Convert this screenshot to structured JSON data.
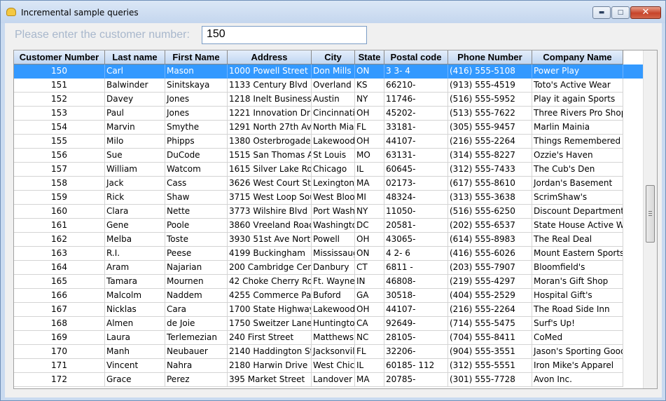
{
  "window": {
    "title": "Incremental sample queries"
  },
  "prompt": {
    "label": "Please enter the customer number:",
    "value": "150"
  },
  "grid": {
    "columns": [
      "Customer Number",
      "Last name",
      "First Name",
      "Address",
      "City",
      "State",
      "Postal code",
      "Phone Number",
      "Company Name"
    ],
    "selected_row": 0,
    "rows": [
      [
        "150",
        "Carl",
        "Mason",
        "1000 Powell Street",
        "Don Mills",
        "ON",
        "3  3- 4",
        "(416) 555-5108",
        "Power Play"
      ],
      [
        "151",
        "Balwinder",
        "Sinitskaya",
        "1133 Century Blvd",
        "Overland P",
        "KS",
        "66210-",
        "(913) 555-4519",
        "Toto's Active Wear"
      ],
      [
        "152",
        "Davey",
        "Jones",
        "1218 Inelt Business C",
        "Austin",
        "NY",
        "11746-",
        "(516) 555-5952",
        "Play it again Sports"
      ],
      [
        "153",
        "Paul",
        "Jones",
        "1221 Innovation Drive",
        "Cincinnati",
        "OH",
        "45202-",
        "(513) 555-7622",
        "Three Rivers Pro Shop"
      ],
      [
        "154",
        "Marvin",
        "Smythe",
        "1291 North 27th Ave",
        "North Miam",
        "FL",
        "33181-",
        "(305) 555-9457",
        "Marlin Mainia"
      ],
      [
        "155",
        "Milo",
        "Phipps",
        "1380 Osterbrogade",
        "Lakewood",
        "OH",
        "44107-",
        "(216) 555-2264",
        "Things Remembered"
      ],
      [
        "156",
        "Sue",
        "DuCode",
        "1515 San Thomas Av",
        "St Louis",
        "MO",
        "63131-",
        "(314) 555-8227",
        "Ozzie's Haven"
      ],
      [
        "157",
        "William",
        "Watcom",
        "1615 Silver Lake Road",
        "Chicago",
        "IL",
        "60645-",
        "(312) 555-7433",
        "The Cub's Den"
      ],
      [
        "158",
        "Jack",
        "Cass",
        "3626 West Court Stre",
        "Lexington",
        "MA",
        "02173-",
        "(617) 555-8610",
        "Jordan's Basement"
      ],
      [
        "159",
        "Rick",
        "Shaw",
        "3715 West Loop Sou",
        "West Bloom",
        "MI",
        "48324-",
        "(313) 555-3638",
        "ScrimShaw's"
      ],
      [
        "160",
        "Clara",
        "Nette",
        "3773 Wilshire Blvd",
        "Port Washi",
        "NY",
        "11050-",
        "(516) 555-6250",
        "Discount Department S"
      ],
      [
        "161",
        "Gene",
        "Poole",
        "3860 Vreeland Road",
        "Washingto",
        "DC",
        "20581-",
        "(202) 555-6537",
        "State House Active We"
      ],
      [
        "162",
        "Melba",
        "Toste",
        "3930 51st Ave North",
        "Powell",
        "OH",
        "43065-",
        "(614) 555-8983",
        "The Real Deal"
      ],
      [
        "163",
        "R.I.",
        "Peese",
        "4199 Buckingham",
        "Mississauga",
        "ON",
        "4  2- 6",
        "(416) 555-6026",
        "Mount Eastern Sports"
      ],
      [
        "164",
        "Aram",
        "Najarian",
        "200 Cambridge Cente",
        "Danbury",
        "CT",
        "6811 -",
        "(203) 555-7907",
        "Bloomfield's"
      ],
      [
        "165",
        "Tamara",
        "Mournen",
        "42 Choke Cherry Road",
        "Ft. Wayne",
        "IN",
        "46808-",
        "(219) 555-4297",
        "Moran's Gift Shop"
      ],
      [
        "166",
        "Malcolm",
        "Naddem",
        "4255 Commerce Park",
        "Buford",
        "GA",
        "30518-",
        "(404) 555-2529",
        "Hospital Gift's"
      ],
      [
        "167",
        "Nicklas",
        "Cara",
        "1700 State Highway",
        "Lakewood",
        "OH",
        "44107-",
        "(216) 555-2264",
        "The Road Side Inn"
      ],
      [
        "168",
        "Almen",
        "de Joie",
        "1750 Sweitzer Lane",
        "Huntington",
        "CA",
        "92649-",
        "(714) 555-5475",
        "Surf's Up!"
      ],
      [
        "169",
        "Laura",
        "Terlemezian",
        "240 First Street",
        "Matthews",
        "NC",
        "28105-",
        "(704) 555-8411",
        "CoMed"
      ],
      [
        "170",
        "Manh",
        "Neubauer",
        "2140 Haddington Stre",
        "Jacksonville",
        "FL",
        "32206-",
        "(904) 555-3551",
        "Jason's Sporting Goods"
      ],
      [
        "171",
        "Vincent",
        "Nahra",
        "2180 Harwin Drive",
        "West Chica",
        "IL",
        "60185- 112",
        "(312) 555-5551",
        "Iron Mike's Apparel"
      ],
      [
        "172",
        "Grace",
        "Perez",
        "395 Market Street",
        "Landover",
        "MA",
        "20785-",
        "(301) 555-7728",
        "Avon Inc."
      ]
    ]
  }
}
